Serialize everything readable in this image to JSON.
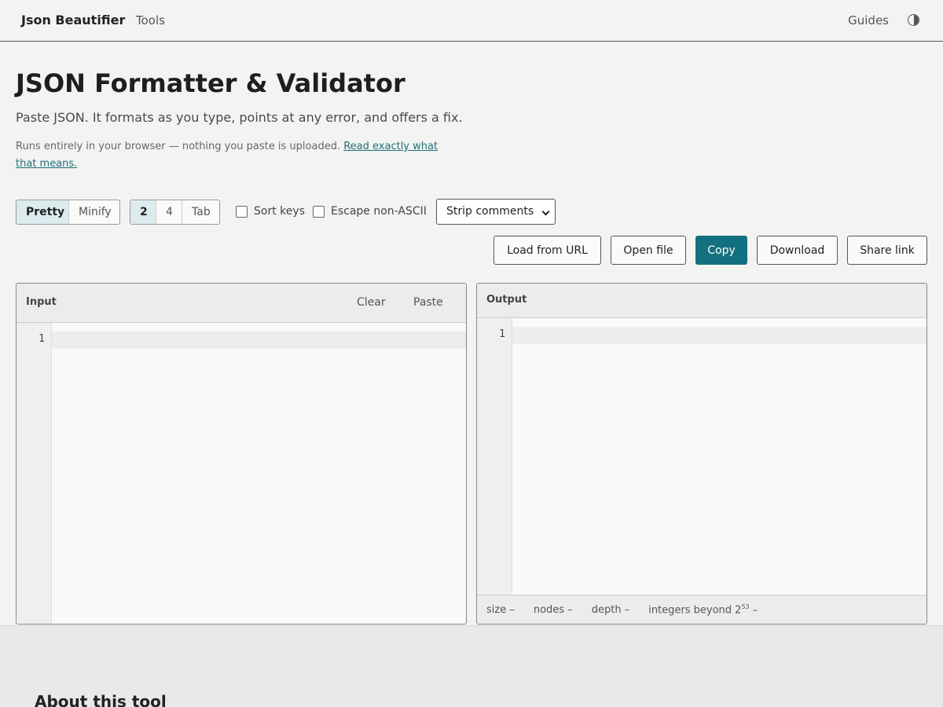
{
  "nav": {
    "brand": "Json Beautifier",
    "tools": "Tools",
    "guides": "Guides",
    "theme_icon": "contrast-icon"
  },
  "hero": {
    "title": "JSON Formatter & Validator",
    "subtitle": "Paste JSON. It formats as you type, points at any error, and offers a fix.",
    "privacy_text": "Runs entirely in your browser — nothing you paste is uploaded.",
    "privacy_link": "Read exactly what that means."
  },
  "toolbar": {
    "mode": {
      "options": [
        "Pretty",
        "Minify"
      ],
      "selected": "Pretty"
    },
    "indent": {
      "options": [
        "2",
        "4",
        "Tab"
      ],
      "selected": "2"
    },
    "sort_keys": {
      "label": "Sort keys",
      "checked": false
    },
    "escape_non_ascii": {
      "label": "Escape non-ASCII",
      "checked": false
    },
    "comments_select": {
      "value": "Strip comments"
    }
  },
  "actions": {
    "load_url": "Load from URL",
    "open_file": "Open file",
    "copy": "Copy",
    "download": "Download",
    "share": "Share link"
  },
  "input_panel": {
    "title": "Input",
    "clear": "Clear",
    "paste": "Paste",
    "line_numbers": [
      "1"
    ]
  },
  "output_panel": {
    "title": "Output",
    "line_numbers": [
      "1"
    ],
    "stats": {
      "size_label": "size",
      "size_value": "–",
      "nodes_label": "nodes",
      "nodes_value": "–",
      "depth_label": "depth",
      "depth_value": "–",
      "integers_label": "integers beyond 2",
      "integers_exp": "53",
      "integers_value": "–"
    }
  },
  "about": {
    "title": "About this tool"
  },
  "colors": {
    "accent": "#12707f",
    "active_segment": "#dcebee",
    "link": "#1f6f7a"
  }
}
